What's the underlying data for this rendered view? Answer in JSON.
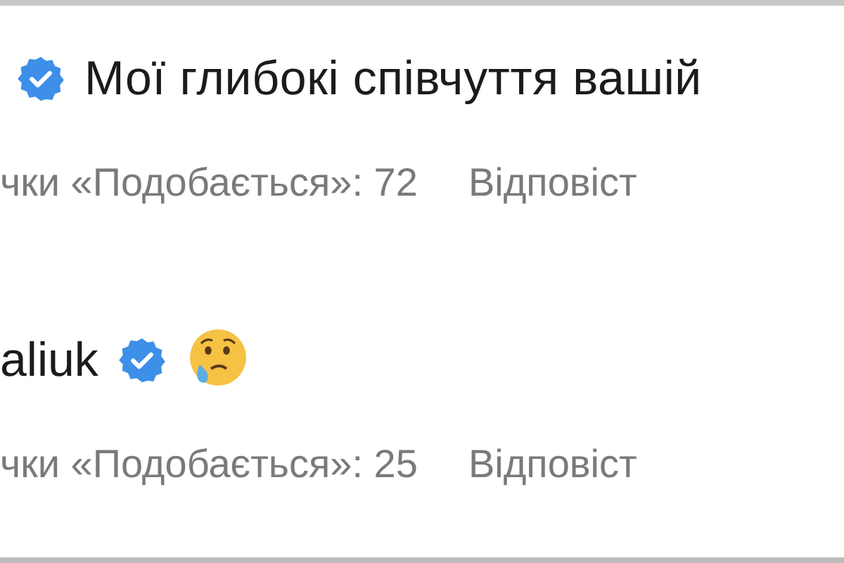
{
  "comments": [
    {
      "verified": true,
      "text": "Мої глибокі співчуття вашій",
      "likes": "чки «Подобається»: 72",
      "reply": "Відповіст"
    },
    {
      "username": "aliuk",
      "verified": true,
      "emoji": true,
      "likes": "чки «Подобається»: 25",
      "reply": "Відповіст"
    }
  ]
}
